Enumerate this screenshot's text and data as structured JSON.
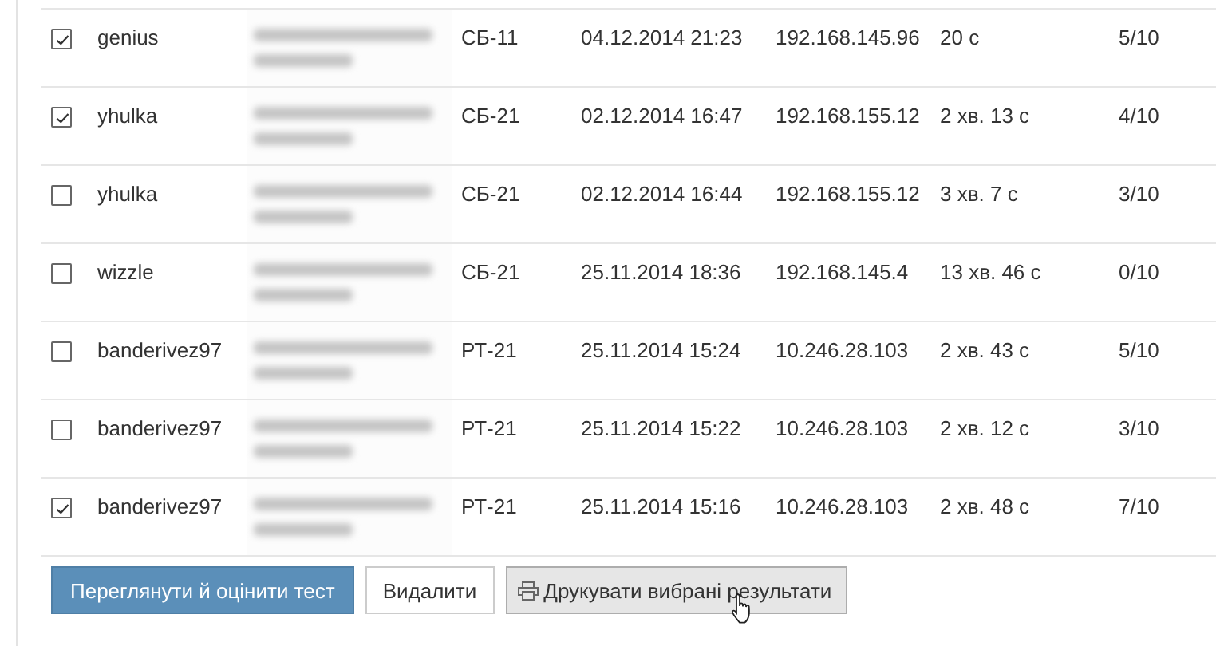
{
  "rows": [
    {
      "checked": true,
      "login": "genius",
      "name_blurred": true,
      "group": "СБ-11",
      "date": "04.12.2014 21:23",
      "ip": "192.168.145.96",
      "duration": "20 с",
      "score": "5/10"
    },
    {
      "checked": true,
      "login": "yhulka",
      "name_blurred": true,
      "group": "СБ-21",
      "date": "02.12.2014 16:47",
      "ip": "192.168.155.12",
      "duration": "2 хв. 13 с",
      "score": "4/10"
    },
    {
      "checked": false,
      "login": "yhulka",
      "name_blurred": true,
      "group": "СБ-21",
      "date": "02.12.2014 16:44",
      "ip": "192.168.155.12",
      "duration": "3 хв. 7 с",
      "score": "3/10"
    },
    {
      "checked": false,
      "login": "wizzle",
      "name_blurred": true,
      "group": "СБ-21",
      "date": "25.11.2014 18:36",
      "ip": "192.168.145.4",
      "duration": "13 хв. 46 с",
      "score": "0/10"
    },
    {
      "checked": false,
      "login": "banderivez97",
      "name_blurred": true,
      "group": "РТ-21",
      "date": "25.11.2014 15:24",
      "ip": "10.246.28.103",
      "duration": "2 хв. 43 с",
      "score": "5/10"
    },
    {
      "checked": false,
      "login": "banderivez97",
      "name_blurred": true,
      "group": "РТ-21",
      "date": "25.11.2014 15:22",
      "ip": "10.246.28.103",
      "duration": "2 хв. 12 с",
      "score": "3/10"
    },
    {
      "checked": true,
      "login": "banderivez97",
      "name_blurred": true,
      "group": "РТ-21",
      "date": "25.11.2014 15:16",
      "ip": "10.246.28.103",
      "duration": "2 хв. 48 с",
      "score": "7/10"
    }
  ],
  "buttons": [
    {
      "kind": "primary",
      "label": "Переглянути й оцінити тест"
    },
    {
      "kind": "default",
      "label": "Видалити"
    },
    {
      "kind": "print",
      "label": "Друкувати вибрані результати"
    }
  ]
}
